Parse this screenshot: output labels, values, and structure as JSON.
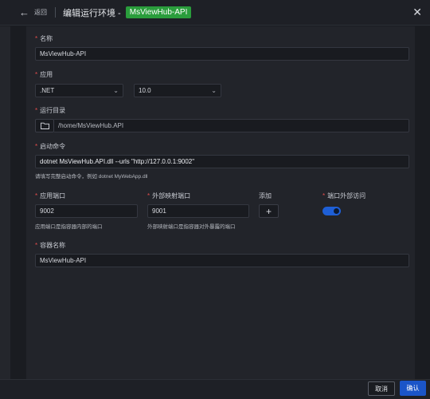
{
  "header": {
    "back_label": "返回",
    "title": "编辑运行环境 -",
    "badge": "MsViewHub-API"
  },
  "form": {
    "name": {
      "label": "名称",
      "value": "MsViewHub-API"
    },
    "app": {
      "label": "应用",
      "runtime": ".NET",
      "version": "10.0"
    },
    "run_dir": {
      "label": "运行目录",
      "value": "/home/MsViewHub.API"
    },
    "start_cmd": {
      "label": "启动命令",
      "value": "dotnet MsViewHub.API.dll --urls \"http://127.0.0.1:9002\"",
      "hint": "请填写完整启动命令，例如 dotnet MyWebApp.dll"
    },
    "app_port": {
      "label": "应用端口",
      "value": "9002",
      "hint": "应用端口是指容器内部的端口"
    },
    "ext_port": {
      "label": "外部映射端口",
      "value": "9001",
      "hint": "外部映射端口是指容器对外暴露的端口"
    },
    "add": {
      "label": "添加",
      "button": "+"
    },
    "port_access": {
      "label": "端口外部访问",
      "enabled": true
    },
    "container_name": {
      "label": "容器名称",
      "value": "MsViewHub-API"
    }
  },
  "footer": {
    "cancel": "取消",
    "confirm": "确认"
  },
  "icons": {
    "back": "arrow-left-icon",
    "close": "close-icon",
    "folder": "folder-icon",
    "chevron": "chevron-down-icon"
  },
  "colors": {
    "accent": "#1b55c8",
    "badge": "#2a9d3c",
    "required": "#e24c4c"
  }
}
